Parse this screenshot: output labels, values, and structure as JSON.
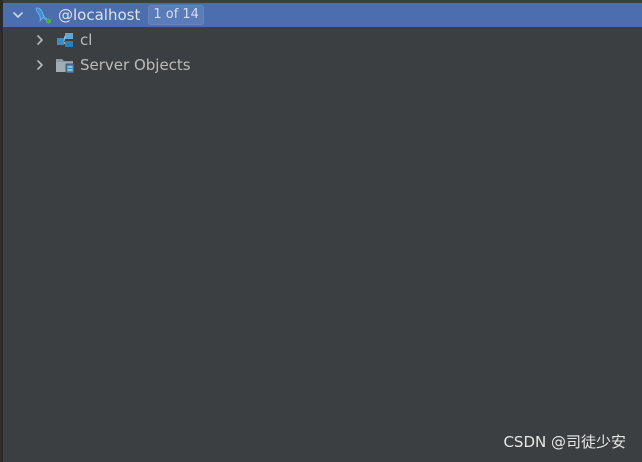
{
  "tree": {
    "root": {
      "label": "@localhost",
      "badge": "1 of 14",
      "icon": "mysql-dolphin-icon",
      "expanded": true
    },
    "children": [
      {
        "label": "cl",
        "icon": "schema-icon",
        "expanded": false
      },
      {
        "label": "Server Objects",
        "icon": "folder-server-objects-icon",
        "expanded": false
      }
    ]
  },
  "watermark": "CSDN @司徒少安",
  "colors": {
    "background": "#3c3f41",
    "selection": "#4b6eaf",
    "text": "#bbbbbb",
    "connected_dot": "#4caf50"
  }
}
